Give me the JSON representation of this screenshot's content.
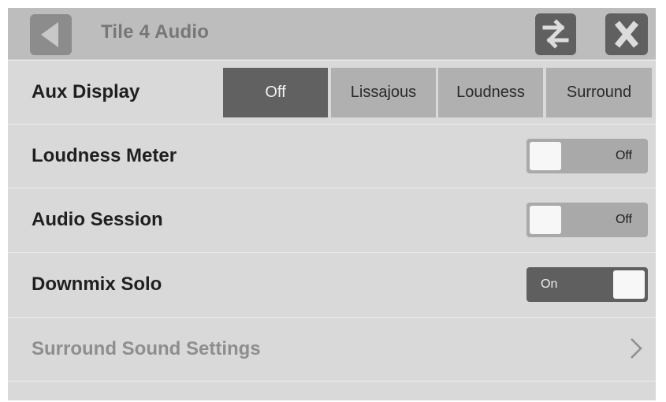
{
  "header": {
    "title": "Tile 4 Audio",
    "back_icon": "triangle-left-icon",
    "swap_icon": "swap-arrows-icon",
    "close_icon": "x-close-icon"
  },
  "aux_display": {
    "label": "Aux Display",
    "options": [
      "Off",
      "Lissajous",
      "Loudness",
      "Surround"
    ],
    "selected": "Off"
  },
  "loudness_meter": {
    "label": "Loudness Meter",
    "state": "Off"
  },
  "audio_session": {
    "label": "Audio Session",
    "state": "Off"
  },
  "downmix_solo": {
    "label": "Downmix Solo",
    "state": "On"
  },
  "surround_settings": {
    "label": "Surround Sound Settings",
    "icon": "chevron-right-icon"
  },
  "colors": {
    "header_bg": "#bdbdbd",
    "panel_bg": "#d9d9d9",
    "active_segment": "#616161",
    "inactive_segment": "#b0b0b0",
    "toggle_on": "#5f5f5f",
    "toggle_off": "#a9a9a9"
  }
}
